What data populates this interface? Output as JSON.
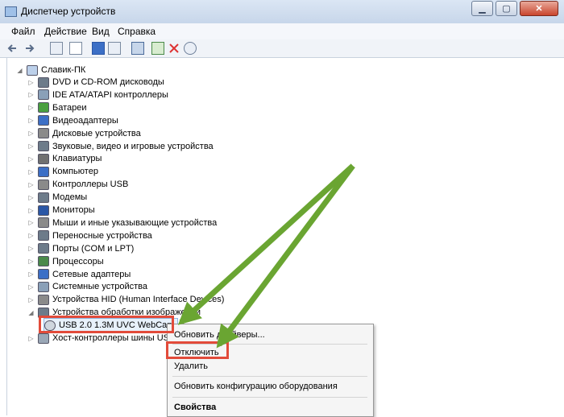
{
  "window": {
    "title": "Диспетчер устройств",
    "min_glyph": "▁",
    "max_glyph": "▢",
    "close_glyph": "✕"
  },
  "menu": [
    "Файл",
    "Действие",
    "Вид",
    "Справка"
  ],
  "toolbar": {
    "icons": [
      "back-icon",
      "forward-icon",
      "properties-icon",
      "list-icon",
      "help-icon",
      "view-icon",
      "update-driver-icon",
      "uninstall-icon",
      "scan-icon"
    ]
  },
  "tree": {
    "root": "Славик-ПК",
    "nodes": [
      "DVD и CD-ROM дисководы",
      "IDE ATA/ATAPI контроллеры",
      "Батареи",
      "Видеоадаптеры",
      "Дисковые устройства",
      "Звуковые, видео и игровые устройства",
      "Клавиатуры",
      "Компьютер",
      "Контроллеры USB",
      "Модемы",
      "Мониторы",
      "Мыши и иные указывающие устройства",
      "Переносные устройства",
      "Порты (COM и LPT)",
      "Процессоры",
      "Сетевые адаптеры",
      "Системные устройства",
      "Устройства HID (Human Interface Devices)",
      "Устройства обработки изображений"
    ],
    "child": "USB 2.0 1.3M UVC WebCam",
    "last": "Хост-контроллеры шины USB"
  },
  "context_menu": {
    "update": "Обновить драйверы...",
    "disable": "Отключить",
    "delete": "Удалить",
    "scan": "Обновить конфигурацию оборудования",
    "properties": "Свойства"
  },
  "colors": {
    "highlight": "#e24b3a",
    "arrow": "#6aa532"
  }
}
